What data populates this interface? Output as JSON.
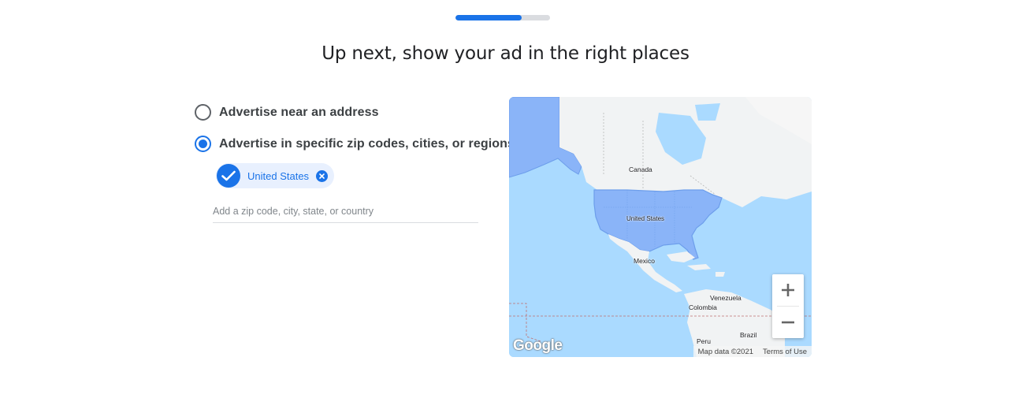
{
  "progress": {
    "percent": 70,
    "fill_color": "#1a73e8"
  },
  "title": "Up next, show your ad in the right places",
  "options": [
    {
      "label": "Advertise near an address",
      "selected": false
    },
    {
      "label": "Advertise in specific zip codes, cities, or regions",
      "selected": true
    }
  ],
  "selected_location": {
    "label": "United States"
  },
  "location_input": {
    "value": "",
    "placeholder": "Add a zip code, city, state, or country"
  },
  "map": {
    "labels": {
      "canada": "Canada",
      "united_states": "United States",
      "mexico": "Mexico",
      "venezuela": "Venezuela",
      "colombia": "Colombia",
      "brazil": "Brazil",
      "peru": "Peru"
    },
    "logo": "Google",
    "attribution": {
      "map_data": "Map data ©2021",
      "terms": "Terms of Use"
    },
    "zoom_in_icon": "plus-icon",
    "zoom_out_icon": "minus-icon",
    "colors": {
      "water": "#aadaff",
      "land": "#f1f3f4",
      "highlight": "#8ab4f8"
    }
  }
}
